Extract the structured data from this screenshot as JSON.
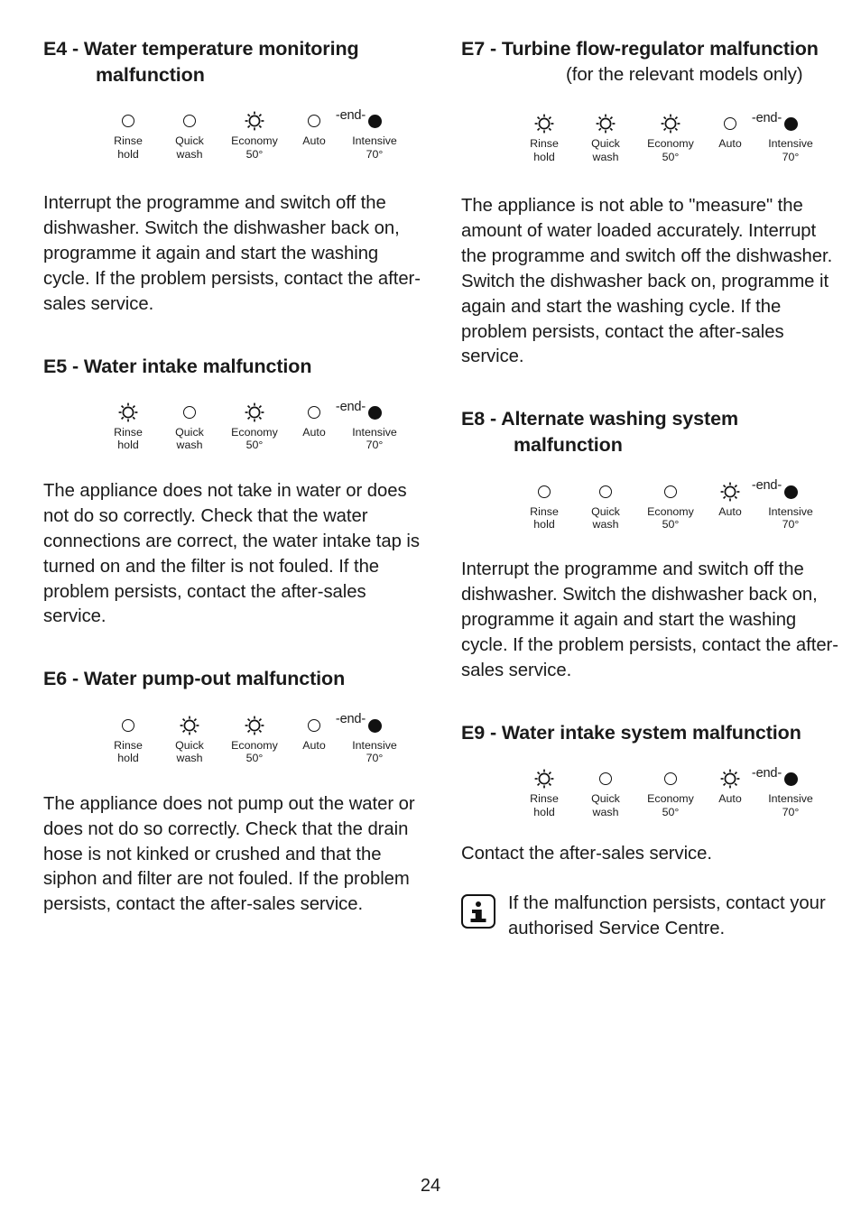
{
  "page": {
    "number": "24",
    "led_label_names": {
      "rinse_hold": "Rinse\nhold",
      "quick_wash": "Quick\nwash",
      "economy": "Economy\n50°",
      "auto": "Auto",
      "intensive": "Intensive\n70°"
    },
    "end_marker": "-end-"
  },
  "sections": {
    "e4": {
      "heading": "E4 - Water temperature monitoring malfunction",
      "leds": [
        {
          "label": "Rinse\nhold",
          "state": "off"
        },
        {
          "label": "Quick\nwash",
          "state": "off"
        },
        {
          "label": "Economy\n50°",
          "state": "blinking"
        },
        {
          "label": "Auto",
          "state": "off"
        },
        {
          "label": "Intensive\n70°",
          "state": "on"
        }
      ],
      "body": "Interrupt the programme and switch off the dishwasher. Switch the dishwasher back on, programme it again and start the washing cycle. If the problem persists, contact the after-sales service."
    },
    "e5": {
      "heading": "E5 - Water intake malfunction",
      "leds": [
        {
          "label": "Rinse\nhold",
          "state": "blinking"
        },
        {
          "label": "Quick\nwash",
          "state": "off"
        },
        {
          "label": "Economy\n50°",
          "state": "blinking"
        },
        {
          "label": "Auto",
          "state": "off"
        },
        {
          "label": "Intensive\n70°",
          "state": "on"
        }
      ],
      "body": "The appliance does not take in water or does not do so correctly. Check that the water connections are correct, the water intake tap is turned on and the filter is not fouled. If the problem persists, contact the after-sales service."
    },
    "e6": {
      "heading": "E6 - Water pump-out malfunction",
      "leds": [
        {
          "label": "Rinse\nhold",
          "state": "off"
        },
        {
          "label": "Quick\nwash",
          "state": "blinking"
        },
        {
          "label": "Economy\n50°",
          "state": "blinking"
        },
        {
          "label": "Auto",
          "state": "off"
        },
        {
          "label": "Intensive\n70°",
          "state": "on"
        }
      ],
      "body": "The appliance does not pump out the water or does not do so correctly. Check that the drain hose is not kinked or crushed and that the siphon and filter are not fouled. If the problem persists, contact the after-sales service."
    },
    "e7": {
      "heading": "E7 - Turbine flow-regulator malfunction",
      "subheading": "(for the relevant models only)",
      "leds": [
        {
          "label": "Rinse\nhold",
          "state": "blinking"
        },
        {
          "label": "Quick\nwash",
          "state": "blinking"
        },
        {
          "label": "Economy\n50°",
          "state": "blinking"
        },
        {
          "label": "Auto",
          "state": "off"
        },
        {
          "label": "Intensive\n70°",
          "state": "on"
        }
      ],
      "body": "The appliance is not able to \"measure\" the amount of water loaded accurately. Interrupt the programme and switch off the dishwasher. Switch the dishwasher back on, programme it again and start the washing cycle. If the problem persists, contact the after-sales service."
    },
    "e8": {
      "heading": "E8 - Alternate washing system malfunction",
      "leds": [
        {
          "label": "Rinse\nhold",
          "state": "off"
        },
        {
          "label": "Quick\nwash",
          "state": "off"
        },
        {
          "label": "Economy\n50°",
          "state": "off"
        },
        {
          "label": "Auto",
          "state": "blinking"
        },
        {
          "label": "Intensive\n70°",
          "state": "on"
        }
      ],
      "body": "Interrupt the programme and switch off the dishwasher. Switch the dishwasher back on, programme it again and start the washing cycle. If the problem persists, contact the after-sales service."
    },
    "e9": {
      "heading": "E9 - Water intake system malfunction",
      "leds": [
        {
          "label": "Rinse\nhold",
          "state": "blinking"
        },
        {
          "label": "Quick\nwash",
          "state": "off"
        },
        {
          "label": "Economy\n50°",
          "state": "off"
        },
        {
          "label": "Auto",
          "state": "blinking"
        },
        {
          "label": "Intensive\n70°",
          "state": "on"
        }
      ],
      "body": "Contact the after-sales service."
    }
  },
  "note": {
    "icon": "info-icon",
    "text": "If the malfunction persists, contact your authorised Service Centre."
  }
}
